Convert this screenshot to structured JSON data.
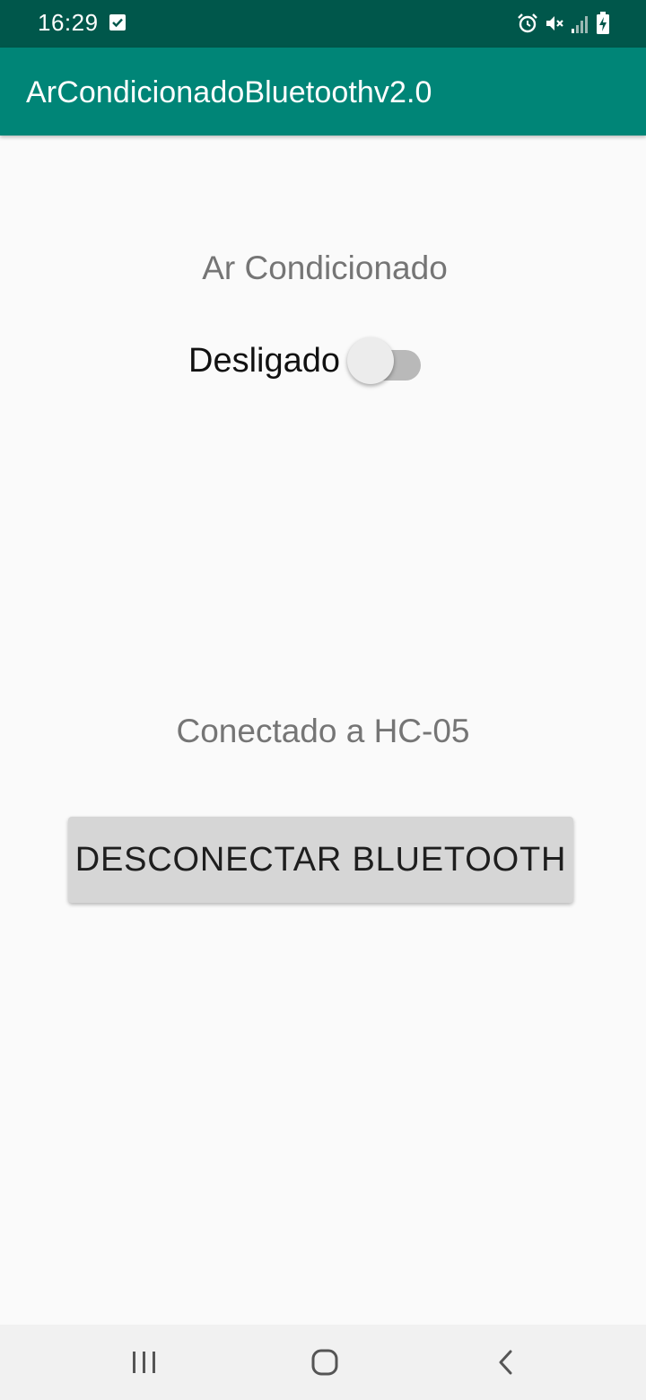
{
  "status_bar": {
    "time": "16:29",
    "icons": [
      "check-box-icon",
      "alarm-icon",
      "mute-icon",
      "signal-icon",
      "battery-charging-icon"
    ]
  },
  "app_bar": {
    "title": "ArCondicionadoBluetoothv2.0",
    "color": "#008577"
  },
  "main": {
    "ac_title": "Ar Condicionado",
    "switch": {
      "label": "Desligado",
      "state": "off"
    },
    "connection_status": "Conectado a HC-05",
    "disconnect_button_label": "DESCONECTAR BLUETOOTH"
  },
  "nav_bar": {
    "buttons": [
      "recent-apps-icon",
      "home-icon",
      "back-icon"
    ]
  },
  "colors": {
    "status_bar": "#00574b",
    "app_bar": "#008577",
    "background": "#fafafa",
    "button": "#d6d6d6"
  }
}
